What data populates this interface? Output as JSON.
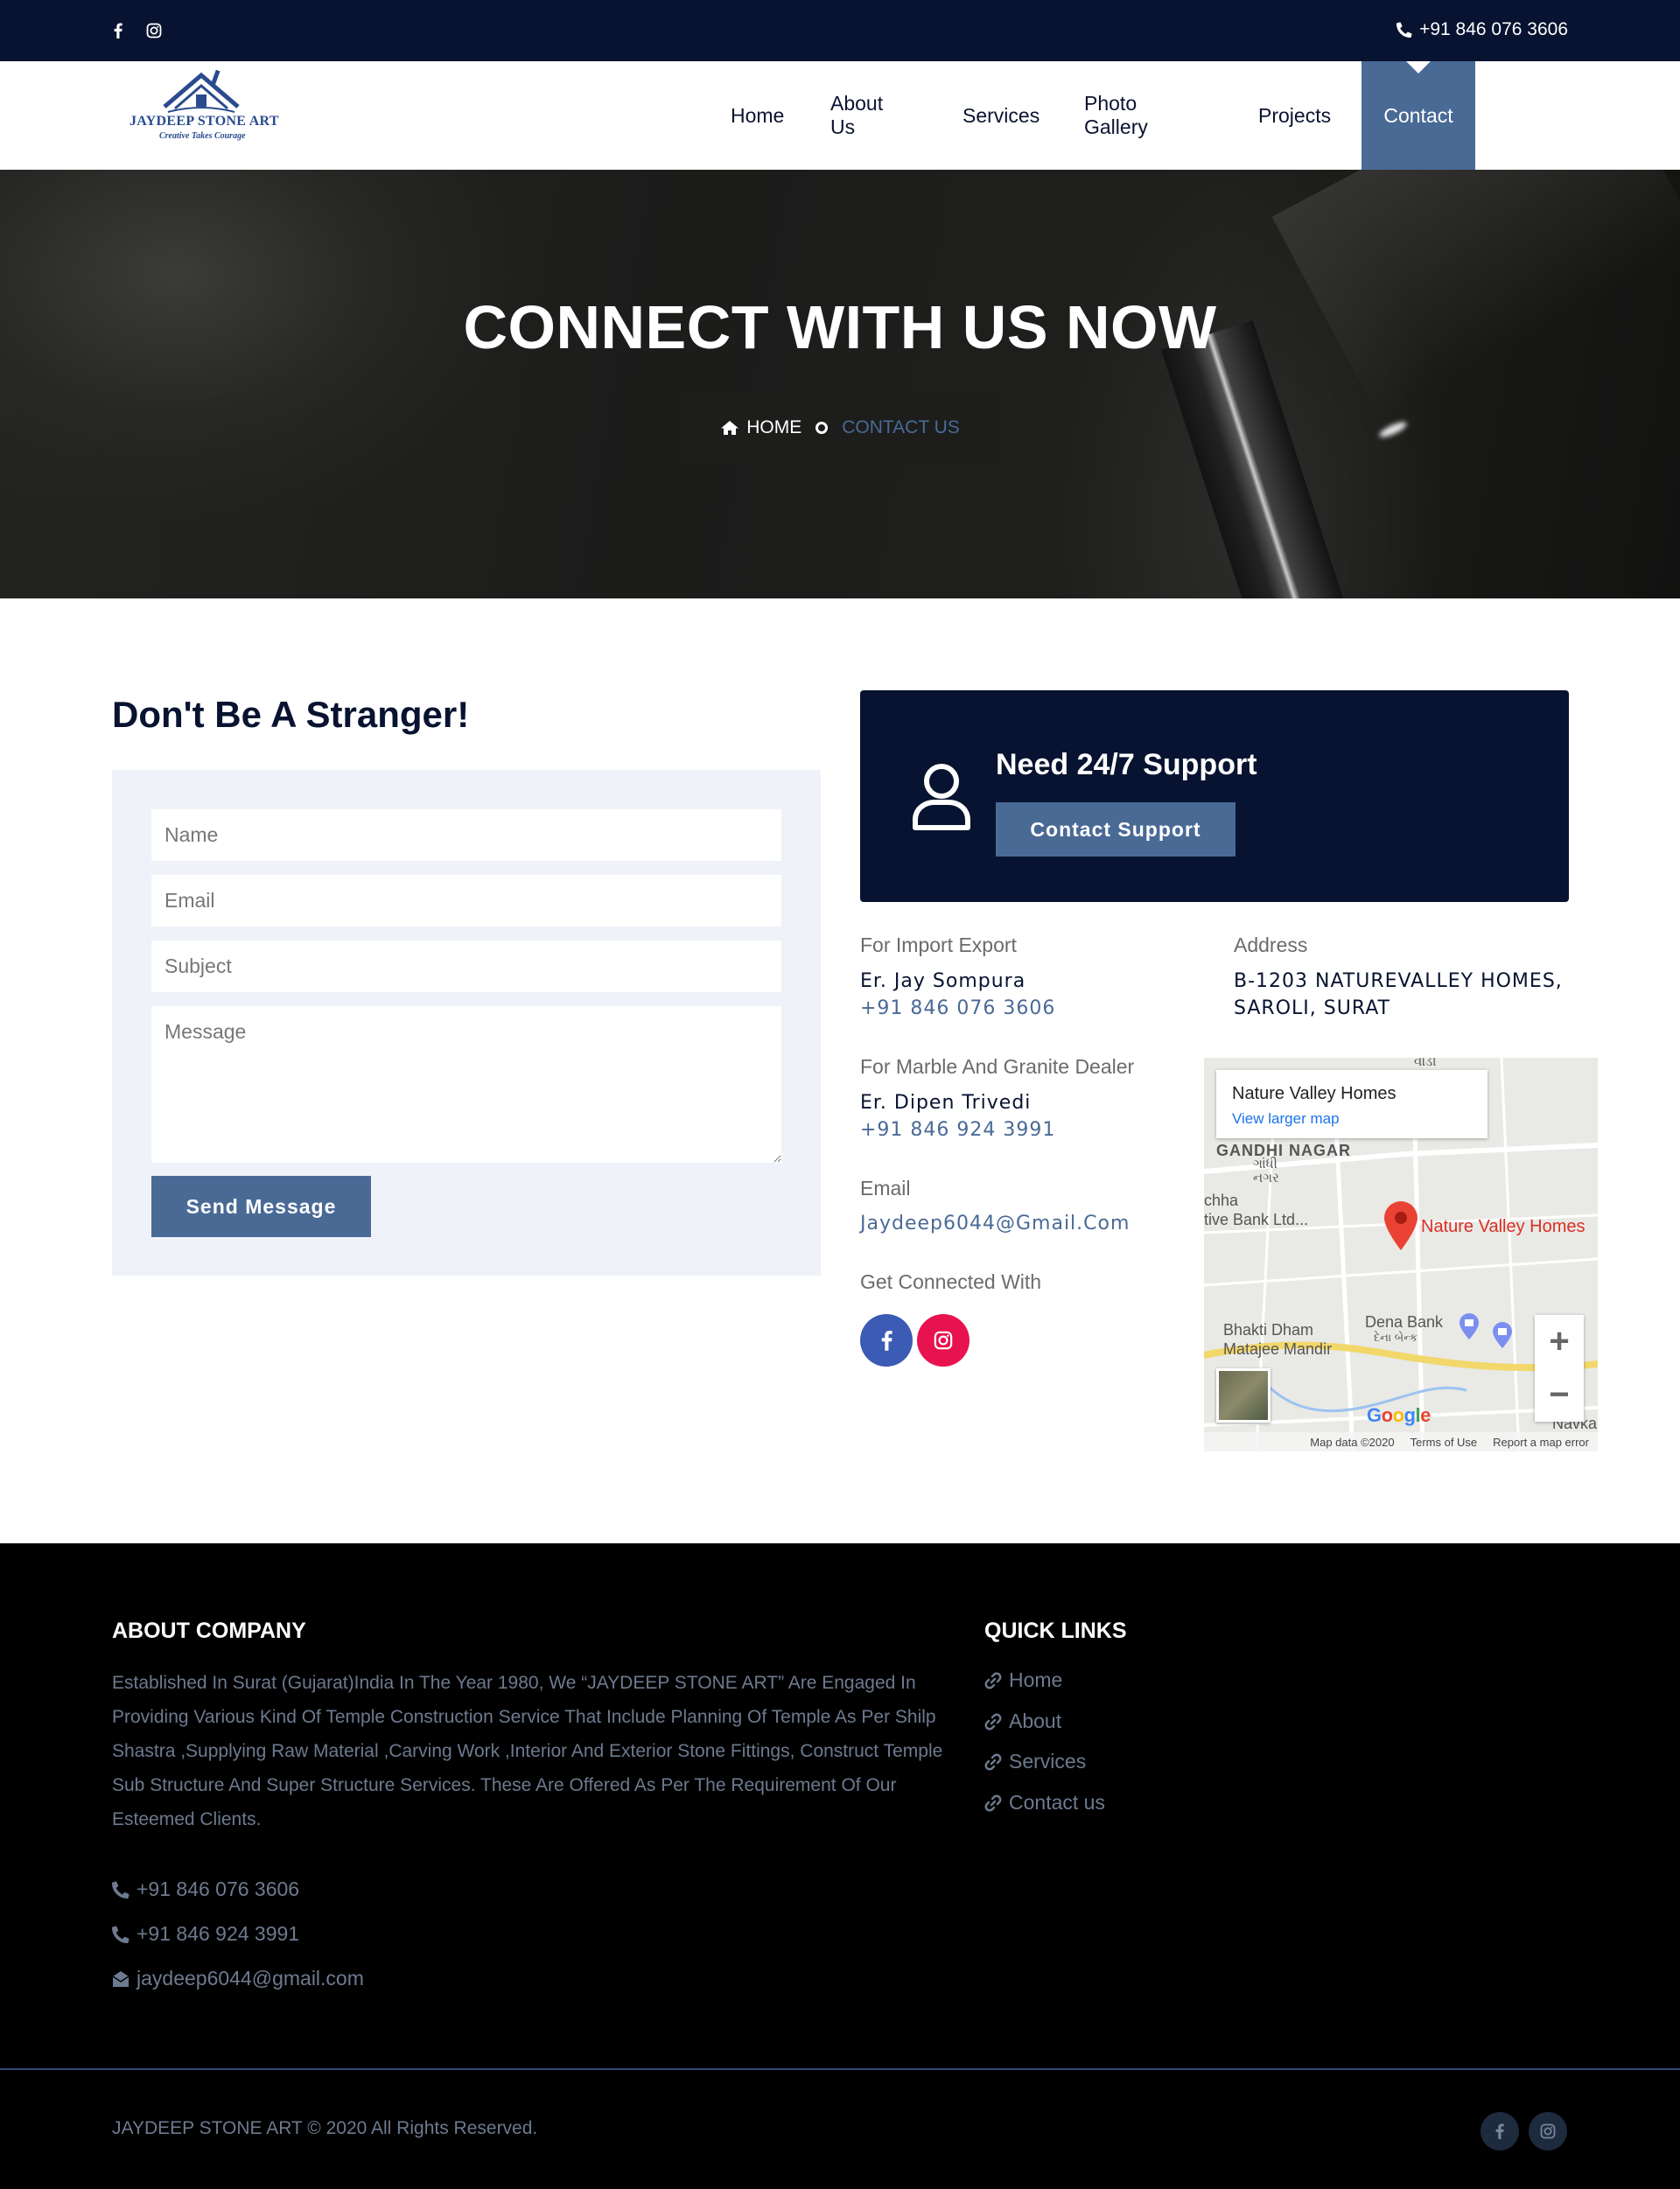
{
  "topbar": {
    "phone": "+91 846 076 3606",
    "social_icons": [
      "facebook-icon",
      "instagram-icon"
    ]
  },
  "brand": {
    "name": "JAYDEEP STONE ART",
    "tagline": "Creative Takes Courage"
  },
  "nav": {
    "items": [
      {
        "label": "Home"
      },
      {
        "label": "About Us"
      },
      {
        "label": "Services"
      },
      {
        "label": "Photo Gallery"
      },
      {
        "label": "Projects"
      },
      {
        "label": "Contact",
        "active": true
      }
    ]
  },
  "hero": {
    "title": "CONNECT WITH US NOW",
    "breadcrumb_home": "HOME",
    "breadcrumb_current": "CONTACT US"
  },
  "form": {
    "heading": "Don't Be A Stranger!",
    "name_placeholder": "Name",
    "email_placeholder": "Email",
    "subject_placeholder": "Subject",
    "message_placeholder": "Message",
    "submit_label": "Send Message"
  },
  "support": {
    "title": "Need 24/7 Support",
    "button_label": "Contact Support"
  },
  "contacts": {
    "import_label": "For Import Export",
    "import_name": "Er. Jay Sompura",
    "import_phone": "+91 846 076 3606",
    "address_label": "Address",
    "address_line1": "B-1203 NATUREVALLEY HOMES,",
    "address_line2": "SAROLI, SURAT",
    "dealer_label": "For Marble And Granite Dealer",
    "dealer_name": "Er. Dipen Trivedi",
    "dealer_phone": "+91 846 924 3991",
    "email_label": "Email",
    "email_value": "Jaydeep6044@Gmail.Com",
    "connected_label": "Get Connected With"
  },
  "map": {
    "place_title": "Nature Valley Homes",
    "view_larger": "View larger map",
    "pin_label": "Nature Valley Homes",
    "area_label": "GANDHI NAGAR",
    "area_local": "ગાંધી\nનગર",
    "top_label": "વાડી",
    "bank_left": "chha\ntive Bank Ltd...",
    "temple": "Bhakti Dham\nMatajee Mandir",
    "bank": "Dena Bank",
    "bank_local": "દેના બેન્ક",
    "right_label": "Navkar",
    "google": "Google",
    "attribution": "Map data ©2020",
    "terms": "Terms of Use",
    "report": "Report a map error"
  },
  "footer": {
    "about_heading": "ABOUT COMPANY",
    "about_text": "Established In Surat (Gujarat)India In The Year 1980, We “JAYDEEP STONE ART” Are Engaged In Providing Various Kind Of Temple Construction Service That Include Planning Of Temple As Per Shilp Shastra ,Supplying Raw Material ,Carving Work ,Interior And Exterior Stone Fittings, Construct Temple Sub Structure And Super Structure Services. These Are Offered As Per The Requirement Of Our Esteemed Clients.",
    "phone1": "+91 846 076 3606",
    "phone2": "+91 846 924 3991",
    "email": "jaydeep6044@gmail.com",
    "links_heading": "QUICK LINKS",
    "links": [
      {
        "label": "Home"
      },
      {
        "label": "About"
      },
      {
        "label": "Services"
      },
      {
        "label": "Contact us"
      }
    ],
    "copyright": "JAYDEEP STONE ART © 2020 All Rights Reserved."
  },
  "colors": {
    "navy": "#071330",
    "accent": "#4a6a96",
    "facebook": "#3b5bb5",
    "instagram": "#e8124f"
  }
}
